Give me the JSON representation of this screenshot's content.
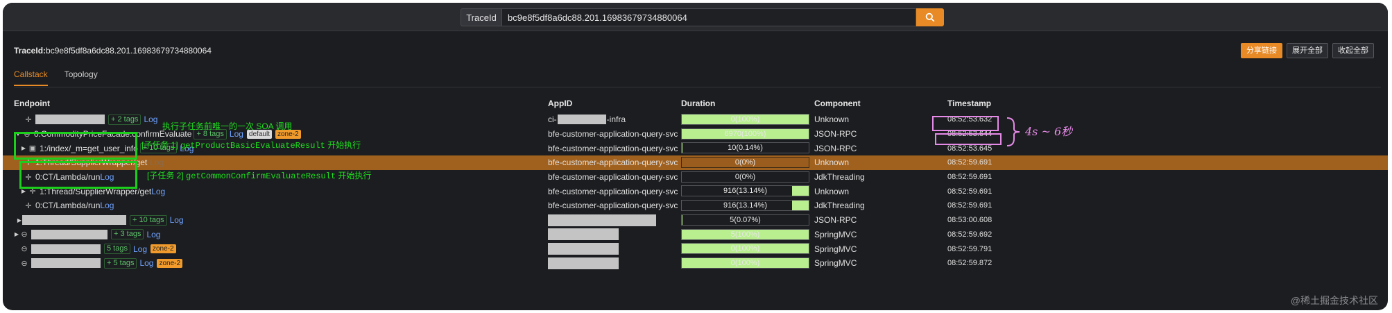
{
  "search": {
    "label": "TraceId",
    "value": "bc9e8f5df8a6dc88.201.16983679734880064"
  },
  "trace": {
    "label": "TraceId:",
    "id": "bc9e8f5df8a6dc88.201.16983679734880064"
  },
  "actions": {
    "share": "分享链接",
    "expand": "展开全部",
    "collapse": "收起全部"
  },
  "tabs": {
    "callstack": "Callstack",
    "topology": "Topology"
  },
  "columns": {
    "endpoint": "Endpoint",
    "appid": "AppID",
    "duration": "Duration",
    "component": "Component",
    "timestamp": "Timestamp"
  },
  "rows": [
    {
      "tags": "+ 2 tags",
      "log": "Log",
      "app_prefix": "ci-",
      "app_suffix": "-infra",
      "duration": "0(100%)",
      "pct": 100,
      "component": "Unknown",
      "ts": "08:52:53.632"
    },
    {
      "caret": "▼",
      "endpoint": "0:CommodityPriceFacade.confirmEvaluate",
      "tags": "+ 8 tags",
      "log": "Log",
      "badge_default": "default",
      "badge_zone": "zone-2",
      "app": "bfe-customer-application-query-svc",
      "duration": "6970(100%)",
      "pct": 100,
      "component": "JSON-RPC",
      "ts": "08:52:53.644"
    },
    {
      "caret": "▶",
      "endpoint": "1:/index/_m=get_user_info",
      "tags": "+ 10 tags",
      "log": "Log",
      "app": "bfe-customer-application-query-svc",
      "duration": "10(0.14%)",
      "pct": 0.14,
      "component": "JSON-RPC",
      "ts": "08:52:53.645"
    },
    {
      "endpoint": "1:Thread/SupplierWrapper/get",
      "log": "Log",
      "app": "bfe-customer-application-query-svc",
      "duration": "0(0%)",
      "pct": 0,
      "component": "Unknown",
      "ts": "08:52:59.691"
    },
    {
      "endpoint": "0:CT/Lambda/run",
      "log": "Log",
      "app": "bfe-customer-application-query-svc",
      "duration": "0(0%)",
      "pct": 0,
      "component": "JdkThreading",
      "ts": "08:52:59.691"
    },
    {
      "caret": "▶",
      "endpoint": "1:Thread/SupplierWrapper/get",
      "log": "Log",
      "app": "bfe-customer-application-query-svc",
      "duration": "916(13.14%)",
      "pct": 13.14,
      "component": "Unknown",
      "ts": "08:52:59.691"
    },
    {
      "endpoint": "0:CT/Lambda/run",
      "log": "Log",
      "app": "bfe-customer-application-query-svc",
      "duration": "916(13.14%)",
      "pct": 13.14,
      "component": "JdkThreading",
      "ts": "08:52:59.691"
    },
    {
      "caret": "▶",
      "tags": "+ 10 tags",
      "log": "Log",
      "duration": "5(0.07%)",
      "pct": 0.07,
      "component": "JSON-RPC",
      "ts": "08:53:00.608"
    },
    {
      "caret": "▶",
      "tags": "+ 3 tags",
      "log": "Log",
      "duration": "5(100%)",
      "pct": 100,
      "component": "SpringMVC",
      "ts": "08:52:59.692"
    },
    {
      "tags": "5 tags",
      "log": "Log",
      "badge_zone": "zone-2",
      "duration": "0(100%)",
      "pct": 100,
      "component": "SpringMVC",
      "ts": "08:52:59.791"
    },
    {
      "tags": "+ 5 tags",
      "log": "Log",
      "badge_zone": "zone-2",
      "duration": "0(100%)",
      "pct": 100,
      "component": "SpringMVC",
      "ts": "08:52:59.872"
    }
  ],
  "annotations": {
    "note_soa": "执行子任务前唯一的一次 SOA 调用",
    "task1": "[子任务 1]",
    "task1_method": "getProductBasicEvaluateResult",
    "task1_suffix": "开始执行",
    "task2": "[子任务 2]",
    "task2_method": "getCommonConfirmEvaluateResult",
    "task2_suffix": "开始执行",
    "gap": "4s ~ 6秒"
  },
  "watermark": "@稀土掘金技术社区",
  "colors": {
    "accent": "#e88a26",
    "bar": "#b9ef8f",
    "link": "#6ea2ff",
    "annotation": "#1ccf1c",
    "highlight": "#e68ae8"
  }
}
